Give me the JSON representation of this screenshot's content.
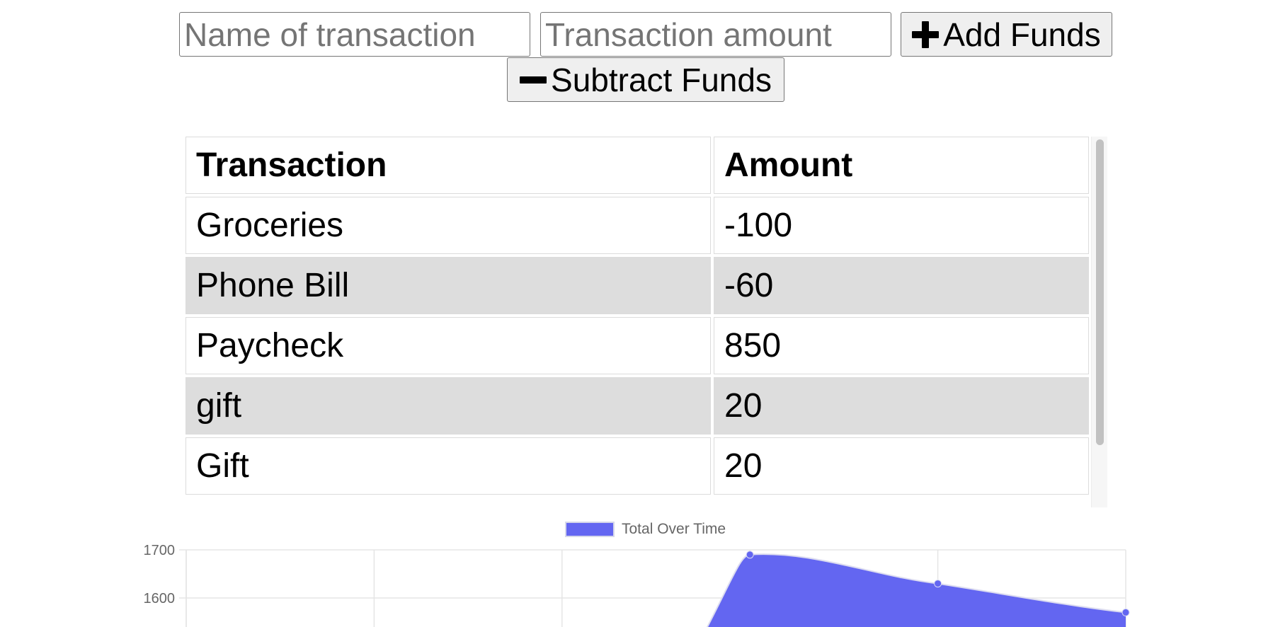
{
  "form": {
    "name_placeholder": "Name of transaction",
    "amount_placeholder": "Transaction amount",
    "add_label": "Add Funds",
    "subtract_label": "Subtract Funds",
    "add_icon": "plus-icon",
    "subtract_icon": "minus-icon"
  },
  "table": {
    "headers": [
      "Transaction",
      "Amount"
    ],
    "rows": [
      {
        "name": "Groceries",
        "amount": "-100"
      },
      {
        "name": "Phone Bill",
        "amount": "-60"
      },
      {
        "name": "Paycheck",
        "amount": "850"
      },
      {
        "name": "gift",
        "amount": "20"
      },
      {
        "name": "Gift",
        "amount": "20"
      }
    ],
    "stripe_color": "#dddddd"
  },
  "chart_data": {
    "type": "area",
    "series": [
      {
        "name": "Total Over Time",
        "values": [
          null,
          null,
          null,
          1690,
          1630,
          1570
        ],
        "color": "#6366f1"
      }
    ],
    "y_ticks": [
      1700,
      1600
    ],
    "ylim": [
      1500,
      1700
    ],
    "grid": true,
    "legend_placement": "top"
  }
}
